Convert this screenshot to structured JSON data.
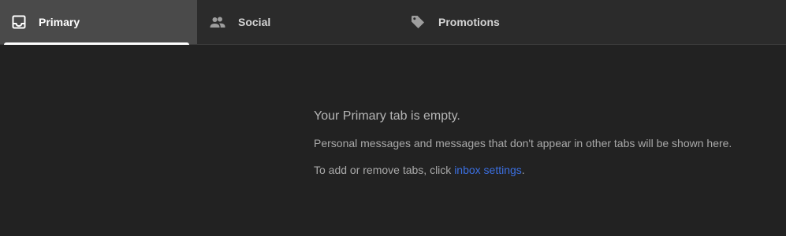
{
  "tabs": {
    "primary": {
      "label": "Primary",
      "icon": "inbox-icon",
      "selected": true
    },
    "social": {
      "label": "Social",
      "icon": "people-icon"
    },
    "promotions": {
      "label": "Promotions",
      "icon": "tag-icon"
    }
  },
  "empty_state": {
    "title": "Your Primary tab is empty.",
    "description": "Personal messages and messages that don't appear in other tabs will be shown here.",
    "settings_prefix": "To add or remove tabs, click ",
    "settings_link": "inbox settings",
    "settings_suffix": "."
  },
  "colors": {
    "background": "#222222",
    "tabbar": "#2b2b2b",
    "selected_tab": "#4a4a4a",
    "link": "#3b6fe0"
  }
}
